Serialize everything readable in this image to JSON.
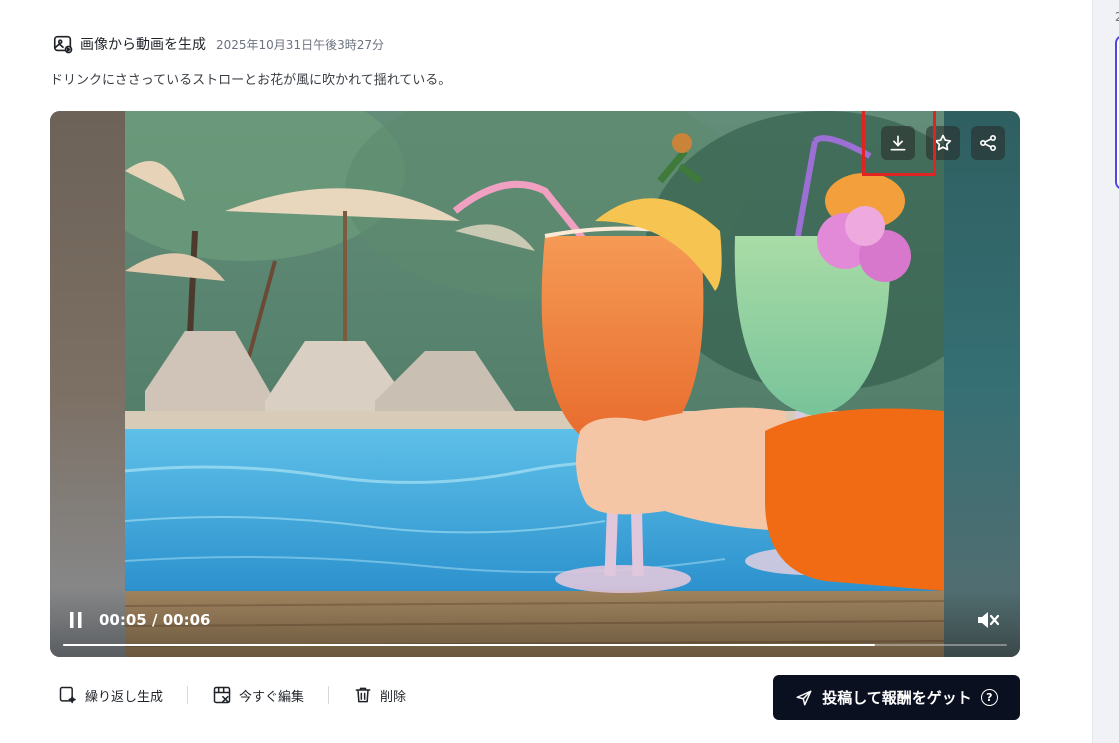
{
  "header": {
    "icon": "image-to-video-icon",
    "title": "画像から動画を生成",
    "timestamp": "2025年10月31日午後3時27分"
  },
  "prompt_text": "ドリンクにささっているストローとお花が風に吹かれて揺れている。",
  "player": {
    "image_description_icons": [
      "download-icon",
      "star-icon",
      "share-icon"
    ],
    "current_time": "00:05",
    "time_separator": "/",
    "duration": "00:06",
    "progress_fraction": 0.86,
    "highlight_color": "#e02424"
  },
  "actions": {
    "regenerate_label": "繰り返し生成",
    "edit_label": "今すぐ編集",
    "delete_label": "削除"
  },
  "post_button": {
    "label": "投稿して報酬をゲット",
    "help": "?"
  },
  "right_panel": {
    "fragment_text": "2"
  },
  "colors": {
    "accent_dark": "#0b1020",
    "panel_border": "#4f46e5"
  }
}
